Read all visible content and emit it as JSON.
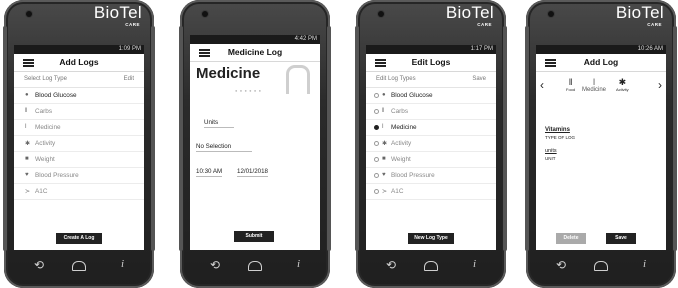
{
  "brand": {
    "logo": "BioTel",
    "sub": "CARE"
  },
  "nav_icons": {
    "back": "back-arrow-icon",
    "home": "home-icon",
    "info": "info-icon"
  },
  "phones": [
    {
      "status_time": "1:09 PM",
      "title": "Add Logs",
      "subhead_left": "Select Log Type",
      "subhead_right": "Edit",
      "items": [
        {
          "icon": "drop-icon",
          "glyph": "●",
          "label": "Blood Glucose"
        },
        {
          "icon": "fork-knife-icon",
          "glyph": "ǁ",
          "label": "Carbs"
        },
        {
          "icon": "medicine-icon",
          "glyph": "ǀ",
          "label": "Medicine"
        },
        {
          "icon": "activity-icon",
          "glyph": "✱",
          "label": "Activity"
        },
        {
          "icon": "scale-icon",
          "glyph": "■",
          "label": "Weight"
        },
        {
          "icon": "blood-pressure-icon",
          "glyph": "♥",
          "label": "Blood Pressure"
        },
        {
          "icon": "a1c-icon",
          "glyph": "≻",
          "label": "A1C"
        }
      ],
      "button": "Create A Log"
    },
    {
      "status_time": "4:42 PM",
      "title": "Medicine Log",
      "heading": "Medicine",
      "units_label": "Units",
      "selection": "No Selection",
      "time": "10:30 AM",
      "date": "12/01/2018",
      "button": "Submit"
    },
    {
      "status_time": "1:17 PM",
      "title": "Edit Logs",
      "subhead_left": "Edit Log Types",
      "subhead_right": "Save",
      "items": [
        {
          "icon": "drop-icon",
          "glyph": "●",
          "label": "Blood Glucose",
          "on": false
        },
        {
          "icon": "fork-knife-icon",
          "glyph": "ǁ",
          "label": "Carbs",
          "on": false
        },
        {
          "icon": "medicine-icon",
          "glyph": "ǀ",
          "label": "Medicine",
          "on": true
        },
        {
          "icon": "activity-icon",
          "glyph": "✱",
          "label": "Activity",
          "on": false
        },
        {
          "icon": "scale-icon",
          "glyph": "■",
          "label": "Weight",
          "on": false
        },
        {
          "icon": "blood-pressure-icon",
          "glyph": "♥",
          "label": "Blood Pressure",
          "on": false
        },
        {
          "icon": "a1c-icon",
          "glyph": "≻",
          "label": "A1C",
          "on": false
        }
      ],
      "button": "New Log Type"
    },
    {
      "status_time": "10:26 AM",
      "title": "Add Log",
      "tabs": [
        {
          "icon": "fork-knife-icon",
          "glyph": "ǁ",
          "label": "Food"
        },
        {
          "icon": "medicine-icon",
          "glyph": "ǀ",
          "label": "Medicine"
        },
        {
          "icon": "activity-icon",
          "glyph": "✱",
          "label": "Activity"
        }
      ],
      "vitamins_value": "Vitamins",
      "vitamins_caption": "TYPE OF LOG",
      "units_value": "units",
      "units_caption": "UNIT",
      "delete_label": "Delete",
      "save_label": "Save"
    }
  ]
}
